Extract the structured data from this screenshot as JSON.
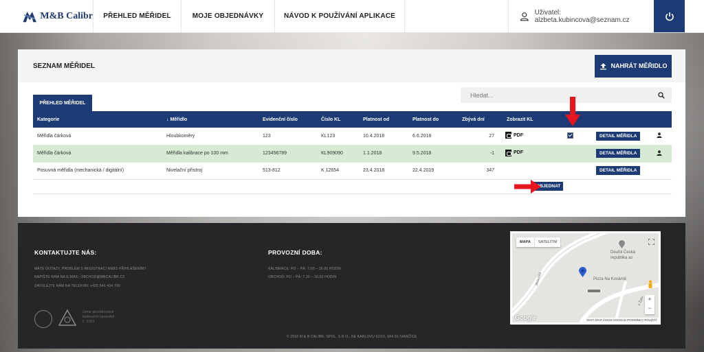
{
  "header": {
    "logo_text": "M&B Calibr",
    "nav": [
      "PŘEHLED MĚŘIDEL",
      "MOJE OBJEDNÁVKY",
      "NÁVOD K POUŽÍVÁNÍ APLIKACE"
    ],
    "user_label": "Uživatel: alzbeta.kubincova@seznam.cz"
  },
  "main": {
    "title": "SEZNAM MĚŘIDEL",
    "upload_label": "NAHRÁT MĚŘIDLO",
    "search_placeholder": "Hledat...",
    "tab_label": "PŘEHLED MĚŘIDEL",
    "columns": [
      "Kategorie",
      "↓ Měřidlo",
      "Evidenční číslo",
      "Číslo KL",
      "Platnost od",
      "Platnost do",
      "Zbývá dní",
      "Zobrazit KL",
      "",
      "",
      ""
    ],
    "rows": [
      {
        "kategorie": "Měřidla čárková",
        "meridlo": "Hloubkoměry",
        "evidencni": "123",
        "cislo_kl": "KL123",
        "od": "10.4.2018",
        "do": "6.6.2018",
        "zbyva": "27",
        "pdf": "PDF",
        "checked": true,
        "detail": "DETAIL MĚŘIDLA",
        "highlight": false
      },
      {
        "kategorie": "Měřidla čárková",
        "meridlo": "Měřidla kalibrace po 100 mm",
        "evidencni": "123456789",
        "cislo_kl": "KL909090",
        "od": "1.1.2018",
        "do": "9.5.2018",
        "zbyva": "-1",
        "pdf": "PDF",
        "checked": false,
        "detail": "DETAIL MĚŘIDLA",
        "highlight": true
      },
      {
        "kategorie": "Posuvná měřidla (mechanická / digitální)",
        "meridlo": "Nivelační přístroj",
        "evidencni": "513-812",
        "cislo_kl": "K 12654",
        "od": "23.4.2018",
        "do": "22.4.2019",
        "zbyva": "347",
        "pdf": "",
        "checked": false,
        "detail": "DETAIL MĚŘIDLA",
        "highlight": false
      }
    ],
    "order_label": "OBJEDNAT"
  },
  "footer": {
    "contact_heading": "KONTAKTUJTE NÁS:",
    "contact_lines": [
      "MÁTE DOTAZY, PROBLÉM S REGISTRACÍ NEBO PŘIHLÁŠENÍM?",
      "NAPIŠTE NÁM NA E-MAIL: OBCHOD@MBCALIBR.CZ",
      "ZAVOLEJTE NÁM NA TELEFON: +420 546 434 700"
    ],
    "hours_heading": "PROVOZNÍ DOBA:",
    "hours_lines": [
      "KALIBRACE: PO – PÁ: 7.00 – 16.00 HODIN",
      "OBCHOD: PO – PÁ: 7.30 – 16.00 HODIN"
    ],
    "accreditation": [
      "Jsme akreditovaná",
      "kalibrační laboratoř",
      "č. 2301"
    ],
    "copyright": "© 2018 M & B CALIBR, SPOL. S R.O., KE KARLOVU 62/10, 664 91 IVANČICE",
    "map": {
      "tabs": [
        "MAPA",
        "SATELITNÍ"
      ],
      "place": "Deufol Česká republika as",
      "poi": "Pizza Na Kovárně",
      "street1": "Jihlavská",
      "street2": "V Žalu",
      "google": "Google",
      "footer_text": "DATA MAP ©2018 GOOGLE   PODMÍNKY POUŽITÍ"
    }
  }
}
